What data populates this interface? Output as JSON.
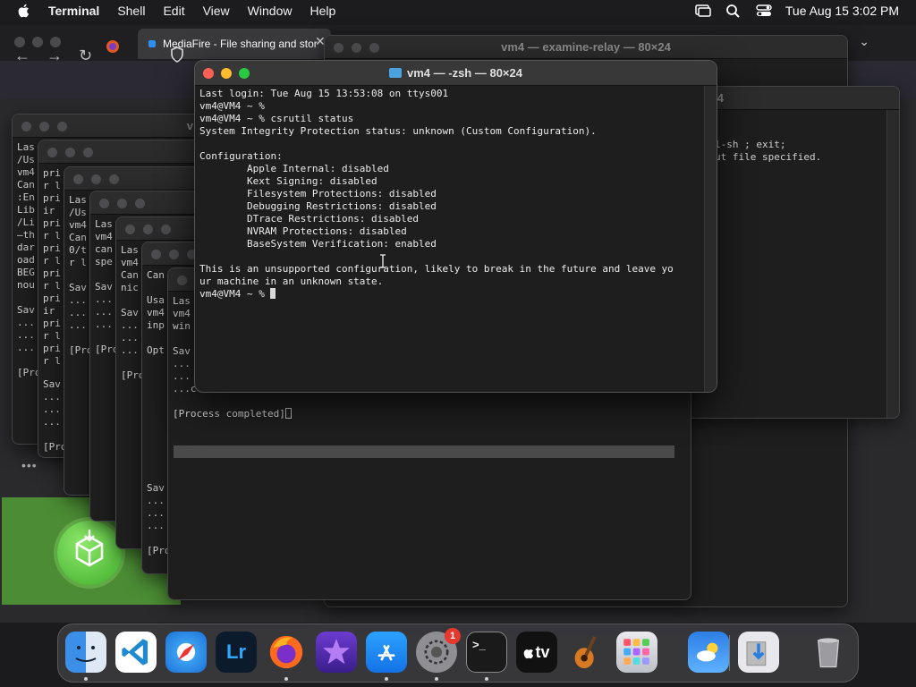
{
  "menubar": {
    "app_name": "Terminal",
    "items": [
      "Shell",
      "Edit",
      "View",
      "Window",
      "Help"
    ],
    "clock": "Tue Aug 15  3:02 PM"
  },
  "browser": {
    "active_tab_title": "MediaFire - File sharing and stor",
    "tab_close": "✕"
  },
  "back_terminals": {
    "examine_relay_title": "vm4 — examine-relay — 80×24",
    "right_window_title": "4",
    "right_window_lines": "l-sh ; exit;\nut file specified.",
    "w1_title": "v",
    "w1_lines": "Las\n/Us\nvm4\nCan\n:En\nLib\n/Li\n—th\ndar\noad\nBEG\nnou\n\nSav\n...\n...\n...\n\n[Pro",
    "w2_lines": "pri\nr l\npri\nir \npri\nr l\npri\nr l\npri\nr l\npri\nir \npri\nr l\npri\nr l",
    "w3_lines": "Las\n/Us\nvm4\nCan\n0/t\nr l\n\nSav\n...\n...\n...\n\n[Pro",
    "w4_lines": "Las\nvm4\ncan\nspe\n\nSav\n...\n...\n...\n\n[Pro",
    "w5_lines": "Las\nvm4\nCan\nnic\n\nSav\n...\n...\n...\n\n[Pro",
    "w6_lines": "Can\n\nUsa\nvm4\ninp\n\nOpt",
    "w6_bottom_lines": "Sav\n...\n...\n...\n\n[Pro",
    "w7_lines": "Las\nvm4\nwin\n\nSav\n...\n...\n...c",
    "process_completed": "[Process completed]"
  },
  "front_terminal": {
    "title": "vm4 — -zsh — 80×24",
    "lines": [
      "Last login: Tue Aug 15 13:53:08 on ttys001",
      "vm4@VM4 ~ %",
      "vm4@VM4 ~ % csrutil status",
      "System Integrity Protection status: unknown (Custom Configuration).",
      "",
      "Configuration:",
      "        Apple Internal: disabled",
      "        Kext Signing: disabled",
      "        Filesystem Protections: disabled",
      "        Debugging Restrictions: disabled",
      "        DTrace Restrictions: disabled",
      "        NVRAM Protections: disabled",
      "        BaseSystem Verification: enabled",
      "",
      "This is an unsupported configuration, likely to break in the future and leave yo",
      "ur machine in an unknown state.",
      "vm4@VM4 ~ % "
    ]
  },
  "dock": {
    "apps": [
      "finder",
      "vscode",
      "safari",
      "lightroom",
      "firefox",
      "imovie",
      "app-store",
      "system-settings",
      "terminal",
      "apple-tv",
      "garageband",
      "launchpad",
      "weather",
      "downloads",
      "trash"
    ],
    "lightroom_label": "Lr",
    "tv_label": "tv",
    "settings_badge": "1",
    "terminal_label": ">_"
  }
}
